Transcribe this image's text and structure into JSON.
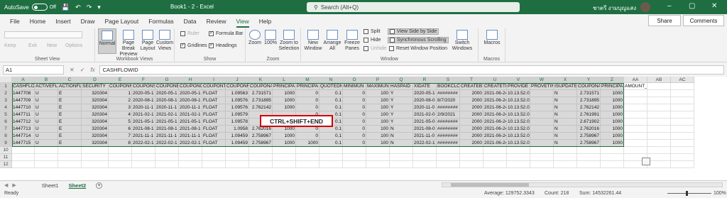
{
  "titlebar": {
    "autosave": "AutoSave",
    "toggle": "Off",
    "title": "Book1 - 2 - Excel",
    "search_placeholder": "Search (Alt+Q)",
    "user": "ชาตรี งามบุญแสง"
  },
  "tabs": [
    "File",
    "Home",
    "Insert",
    "Draw",
    "Page Layout",
    "Formulas",
    "Data",
    "Review",
    "View",
    "Help"
  ],
  "active_tab": "View",
  "share": "Share",
  "comments": "Comments",
  "ribbon": {
    "sheet_view": {
      "label": "Sheet View",
      "items": [
        "Keep",
        "Exit",
        "New",
        "Options"
      ]
    },
    "workbook_views": {
      "label": "Workbook Views",
      "normal": "Normal",
      "page_break": "Page Break Preview",
      "page_layout": "Page Layout",
      "custom": "Custom Views"
    },
    "show": {
      "label": "Show",
      "ruler": "Ruler",
      "formula_bar": "Formula Bar",
      "gridlines": "Gridlines",
      "headings": "Headings"
    },
    "zoom": {
      "label": "Zoom",
      "zoom": "Zoom",
      "zoom100": "100%",
      "zoom_sel": "Zoom to Selection"
    },
    "window": {
      "label": "Window",
      "new": "New Window",
      "arrange": "Arrange All",
      "freeze": "Freeze Panes",
      "split": "Split",
      "hide": "Hide",
      "unhide": "Unhide",
      "side_by_side": "View Side by Side",
      "sync_scroll": "Synchronous Scrolling",
      "reset_pos": "Reset Window Position",
      "switch": "Switch Windows"
    },
    "macros": {
      "label": "Macros",
      "macros": "Macros"
    }
  },
  "namebox": "A1",
  "formula": "CASHFLOWID",
  "columns": [
    "A",
    "B",
    "C",
    "D",
    "E",
    "F",
    "G",
    "H",
    "I",
    "J",
    "K",
    "L",
    "M",
    "N",
    "O",
    "P",
    "Q",
    "R",
    "S",
    "T",
    "U",
    "V",
    "W",
    "X",
    "Y",
    "Z",
    "AA",
    "AB",
    "AC"
  ],
  "rows": [
    "1",
    "2",
    "3",
    "4",
    "5",
    "6",
    "7",
    "8",
    "9",
    "10",
    "11",
    "12"
  ],
  "headers": [
    "CASHFLOW",
    "ACTIVEFL",
    "ACTIONFL",
    "SECURITY",
    "COUPONN",
    "COUPONS",
    "COUPONE",
    "COUPONC",
    "COUPONT",
    "COUPONR",
    "COUPONA",
    "PRINCIPA",
    "PRINCIPA",
    "QUOTEDN",
    "MINIMUN",
    "MAXIMUN",
    "HASPAID",
    "XIDATE",
    "BOOKCLO",
    "CREATEBY",
    "CREATETI",
    "PROVIDE",
    "PROVETIN",
    "ISUPDATE",
    "COUPONA",
    "PRINCIPA",
    "AMOUNT_TSD"
  ],
  "data": [
    [
      "1447708",
      "U",
      "E",
      "320304",
      "1",
      "2020-05-1",
      "2020-05-1",
      "2020-05-1",
      "FLOAT",
      "1.09563",
      "2.731571",
      "1000",
      "0",
      "0.1",
      "0",
      "100",
      "Y",
      "2020-05-1",
      "########",
      "2000",
      "2021-06-24",
      "10.13.52.000000",
      "",
      "N",
      "2.731571",
      "1000"
    ],
    [
      "1447709",
      "U",
      "E",
      "320304",
      "2",
      "2020-08-1",
      "2020-08-1",
      "2020-08-1",
      "FLOAT",
      "1.09576",
      "2.731895",
      "1000",
      "0",
      "0.1",
      "0",
      "100",
      "Y",
      "2020-08-0",
      "8/7/2020",
      "2000",
      "2021-06-24",
      "10.13.52.000000",
      "",
      "N",
      "2.731895",
      "1000"
    ],
    [
      "1447710",
      "U",
      "E",
      "320304",
      "3",
      "2020-11-1",
      "2020-11-1",
      "2020-11-1",
      "FLOAT",
      "1.09576",
      "2.762142",
      "1000",
      "0",
      "0.1",
      "0",
      "100",
      "Y",
      "2020-11-0",
      "########",
      "2000",
      "2021-06-24",
      "10.13.52.000000",
      "",
      "N",
      "2.762142",
      "1000"
    ],
    [
      "1447711",
      "U",
      "E",
      "320304",
      "4",
      "2021-02-1",
      "2021-02-1",
      "2021-02-1",
      "FLOAT",
      "1.09579",
      "",
      "",
      "0",
      "0.1",
      "0",
      "100",
      "Y",
      "2021-02-0",
      "2/9/2021",
      "2000",
      "2021-06-24",
      "10.13.52.000000",
      "",
      "N",
      "2.761991",
      "1000"
    ],
    [
      "1447712",
      "U",
      "E",
      "320304",
      "5",
      "2021-05-1",
      "2021-05-1",
      "2021-05-1",
      "FLOAT",
      "1.09578",
      "",
      "",
      "0",
      "0.1",
      "0",
      "100",
      "Y",
      "2021-05-0",
      "########",
      "2000",
      "2021-06-24",
      "10.13.52.000000",
      "",
      "N",
      "2.671902",
      "1000"
    ],
    [
      "1447713",
      "U",
      "E",
      "320304",
      "6",
      "2021-08-1",
      "2021-08-1",
      "2021-08-1",
      "FLOAT",
      "1.0958",
      "2.762016",
      "1000",
      "0",
      "0.1",
      "0",
      "100",
      "N",
      "2021-08-0",
      "########",
      "2000",
      "2021-06-24",
      "10.13.52.000000",
      "",
      "N",
      "2.762016",
      "1000"
    ],
    [
      "1447714",
      "U",
      "E",
      "320304",
      "7",
      "2021-11-1",
      "2021-11-1",
      "2021-11-1",
      "FLOAT",
      "1.09459",
      "2.758967",
      "1000",
      "0",
      "0.1",
      "0",
      "100",
      "N",
      "2021-11-0",
      "########",
      "2000",
      "2021-06-24",
      "10.13.52.000000",
      "",
      "N",
      "2.758967",
      "1000"
    ],
    [
      "1447715",
      "U",
      "E",
      "320304",
      "8",
      "2022-02-1",
      "2022-02-1",
      "2022-02-1",
      "FLOAT",
      "1.09459",
      "2.758967",
      "1000",
      "1000",
      "0.1",
      "0",
      "100",
      "N",
      "2022-02-1",
      "########",
      "2000",
      "2021-06-24",
      "10.13.52.000000",
      "",
      "N",
      "2.758967",
      "1000"
    ]
  ],
  "callout": "CTRL+SHIFT+END",
  "sheets": [
    "Sheet1",
    "Sheet2"
  ],
  "active_sheet": "Sheet2",
  "status": {
    "ready": "Ready",
    "average": "Average: 129752.3343",
    "count": "Count: 218",
    "sum": "Sum: 14532261.44",
    "zoom": "100%"
  }
}
